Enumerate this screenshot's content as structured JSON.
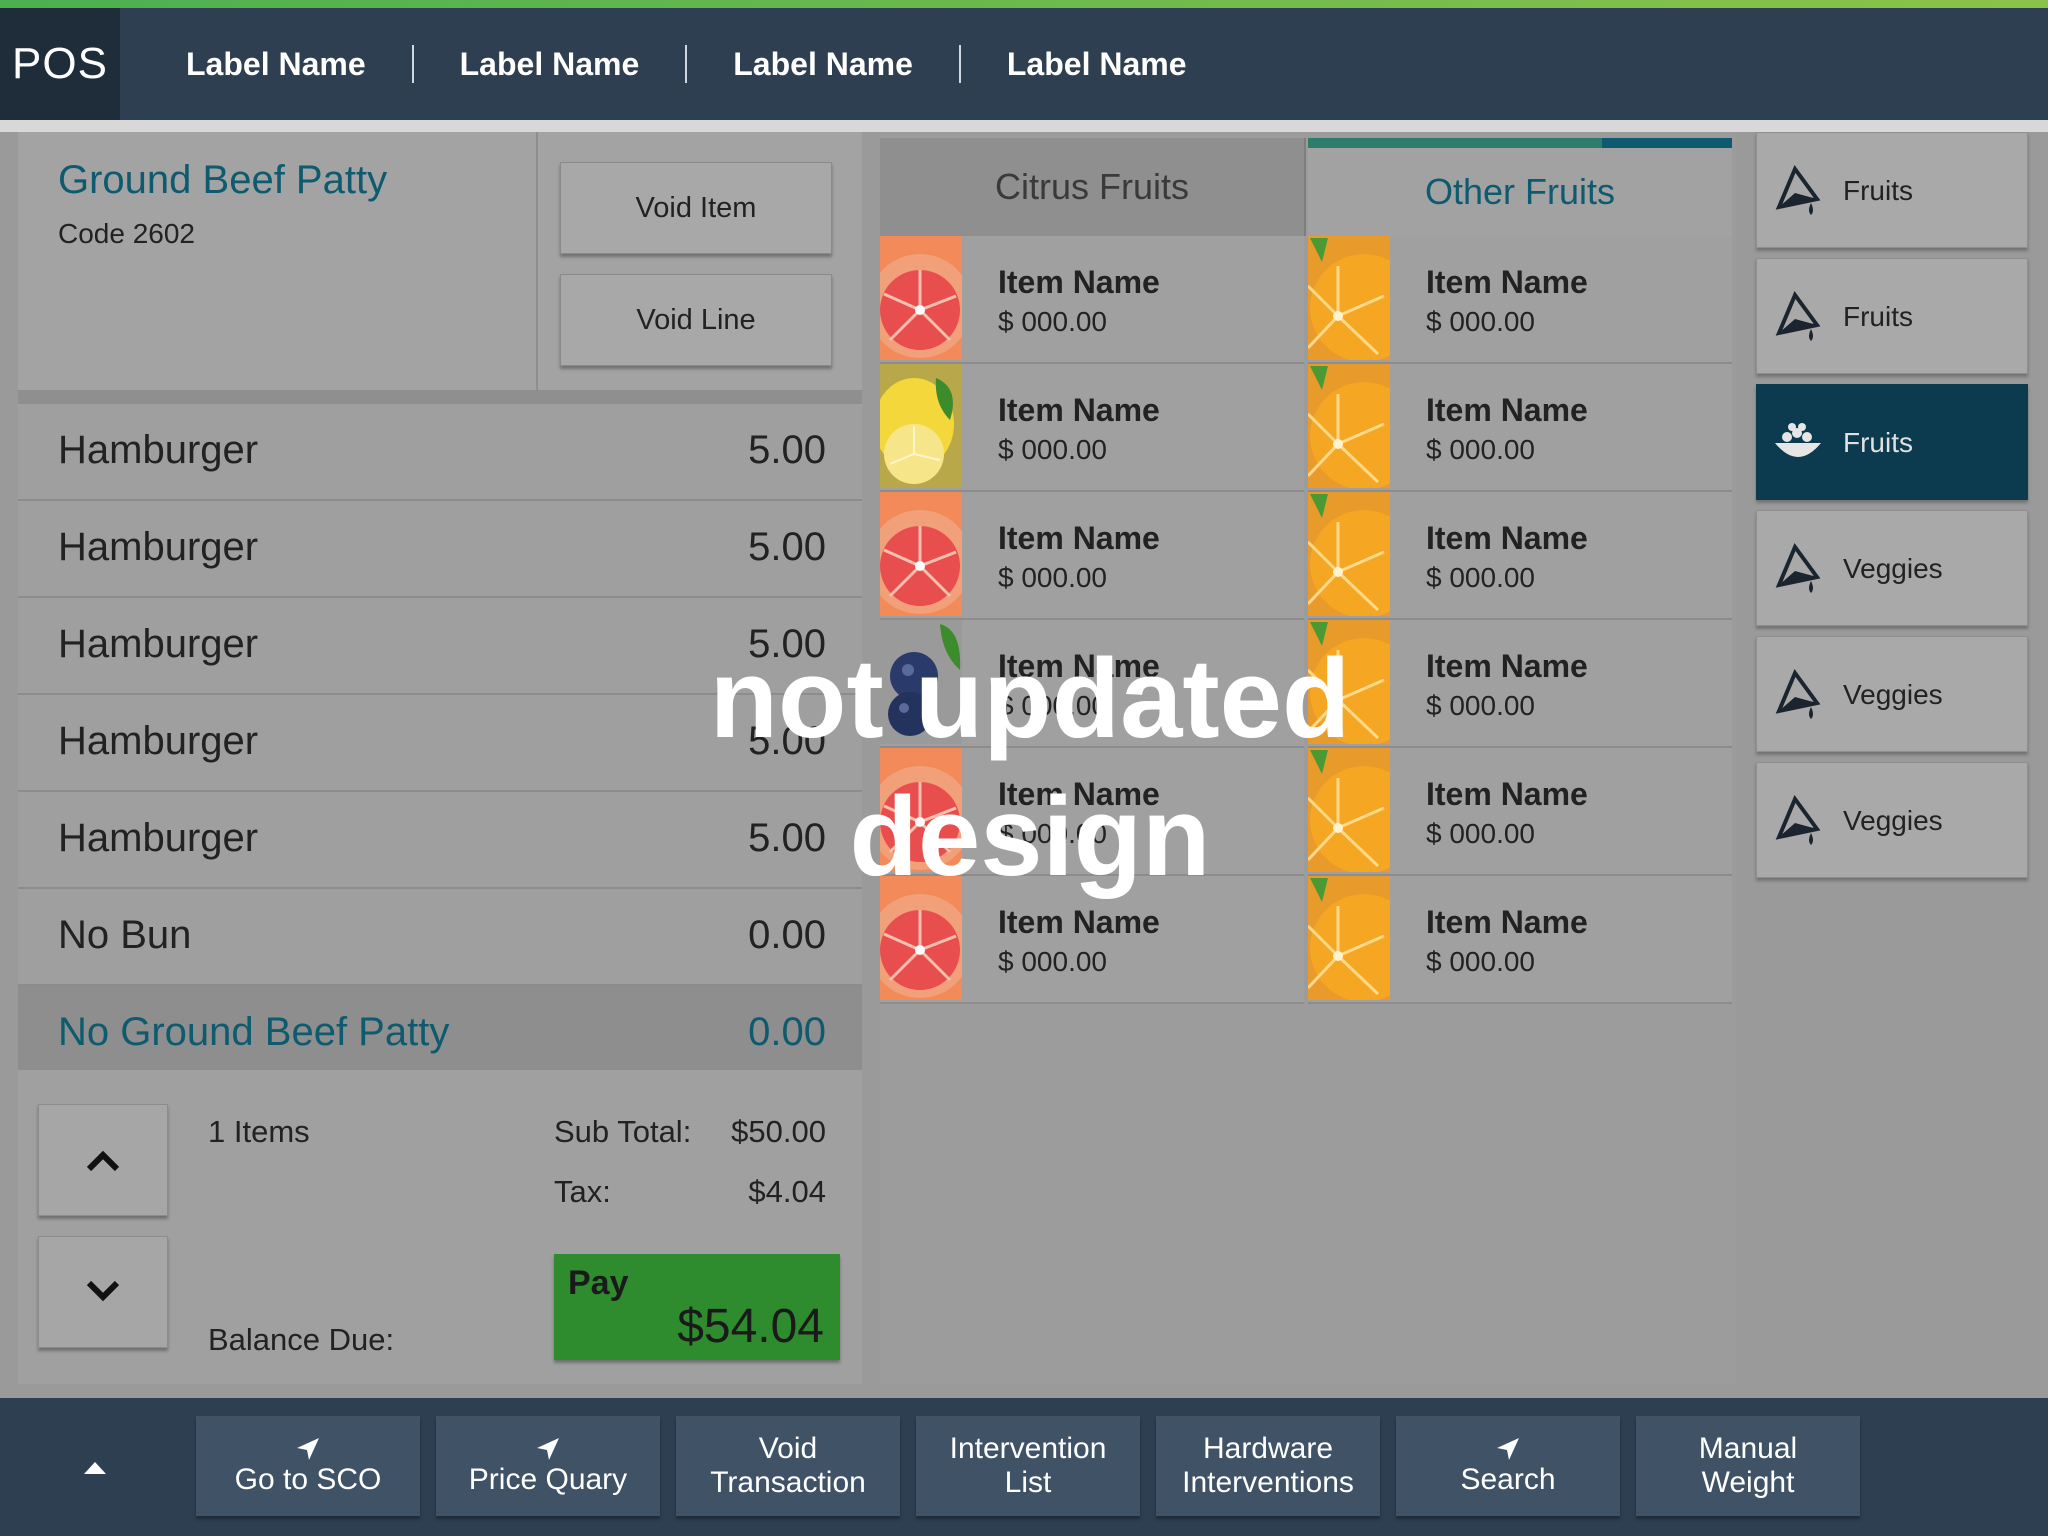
{
  "app": {
    "logo": "POS"
  },
  "topnav": [
    "Label Name",
    "Label Name",
    "Label Name",
    "Label Name"
  ],
  "item_header": {
    "title": "Ground Beef Patty",
    "code": "Code 2602",
    "void_item": "Void Item",
    "void_line": "Void Line"
  },
  "lines": [
    {
      "name": "Hamburger",
      "price": "5.00"
    },
    {
      "name": "Hamburger",
      "price": "5.00"
    },
    {
      "name": "Hamburger",
      "price": "5.00"
    },
    {
      "name": "Hamburger",
      "price": "5.00"
    },
    {
      "name": "Hamburger",
      "price": "5.00"
    },
    {
      "name": "No Bun",
      "price": "0.00"
    },
    {
      "name": "No Ground Beef Patty",
      "price": "0.00",
      "selected": true
    }
  ],
  "totals": {
    "items_count": "1 Items",
    "sub_total_label": "Sub Total:",
    "sub_total_value": "$50.00",
    "tax_label": "Tax:",
    "tax_value": "$4.04",
    "balance_label": "Balance Due:",
    "pay_label": "Pay",
    "pay_amount": "$54.04"
  },
  "tabs": [
    {
      "label": "Citrus Fruits",
      "active": false
    },
    {
      "label": "Other Fruits",
      "active": true
    }
  ],
  "products": {
    "left": [
      {
        "name": "Item Name",
        "price": "$ 000.00",
        "image": "grapefruit"
      },
      {
        "name": "Item Name",
        "price": "$ 000.00",
        "image": "lemon"
      },
      {
        "name": "Item Name",
        "price": "$ 000.00",
        "image": "grapefruit"
      },
      {
        "name": "Item Name",
        "price": "$ 000.00",
        "image": "blueberry"
      },
      {
        "name": "Item Name",
        "price": "$ 000.00",
        "image": "grapefruit"
      },
      {
        "name": "Item Name",
        "price": "$ 000.00",
        "image": "grapefruit"
      }
    ],
    "right": [
      {
        "name": "Item Name",
        "price": "$ 000.00",
        "image": "orange"
      },
      {
        "name": "Item Name",
        "price": "$ 000.00",
        "image": "orange"
      },
      {
        "name": "Item Name",
        "price": "$ 000.00",
        "image": "orange"
      },
      {
        "name": "Item Name",
        "price": "$ 000.00",
        "image": "orange"
      },
      {
        "name": "Item Name",
        "price": "$ 000.00",
        "image": "orange"
      },
      {
        "name": "Item Name",
        "price": "$ 000.00",
        "image": "orange"
      }
    ]
  },
  "categories": [
    {
      "label": "Fruits",
      "icon": "funnel-drop-icon",
      "active": false
    },
    {
      "label": "Fruits",
      "icon": "funnel-drop-icon",
      "active": false
    },
    {
      "label": "Fruits",
      "icon": "fruit-bowl-icon",
      "active": true
    },
    {
      "label": "Veggies",
      "icon": "funnel-drop-icon",
      "active": false
    },
    {
      "label": "Veggies",
      "icon": "funnel-drop-icon",
      "active": false
    },
    {
      "label": "Veggies",
      "icon": "funnel-drop-icon",
      "active": false
    }
  ],
  "function_buttons": [
    {
      "line1": "Go to SCO",
      "line2": "",
      "icon": "navigation-arrow-icon"
    },
    {
      "line1": "Price Quary",
      "line2": "",
      "icon": "navigation-arrow-icon"
    },
    {
      "line1": "Void",
      "line2": "Transaction",
      "icon": ""
    },
    {
      "line1": "Intervention",
      "line2": "List",
      "icon": ""
    },
    {
      "line1": "Hardware",
      "line2": "Interventions",
      "icon": ""
    },
    {
      "line1": "Search",
      "line2": "",
      "icon": "navigation-arrow-icon"
    },
    {
      "line1": "Manual",
      "line2": "Weight",
      "icon": ""
    }
  ],
  "watermark": {
    "line1": "not updated",
    "line2": "design"
  },
  "colors": {
    "accent": "#0e5a6e",
    "pay": "#2e8b2e",
    "topbar": "#2e3f52",
    "active_category": "#0c3a4e"
  }
}
